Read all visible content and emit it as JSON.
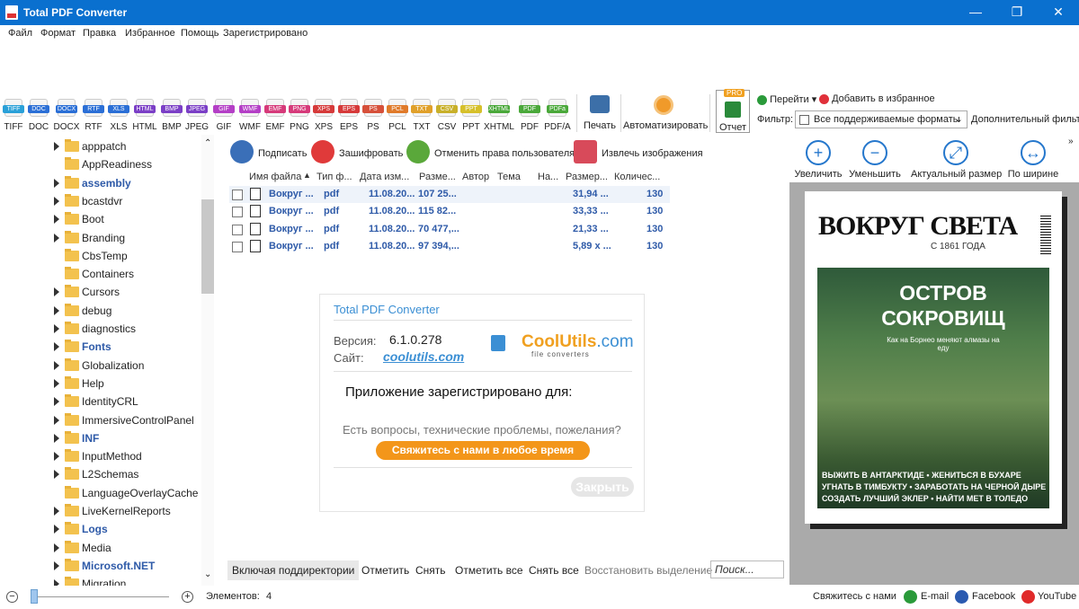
{
  "window": {
    "title": "Total PDF Converter",
    "controls": [
      "—",
      "❐",
      "✕"
    ]
  },
  "menu": [
    "Файл",
    "Формат",
    "Правка",
    "Избранное",
    "Помощь",
    "Зарегистрировано"
  ],
  "formats": [
    {
      "badge": "TIFF",
      "label": "TIFF",
      "color": "#2aa0d8"
    },
    {
      "badge": "DOC",
      "label": "DOC",
      "color": "#2b6fd6"
    },
    {
      "badge": "DOCX",
      "label": "DOCX",
      "color": "#2b6fd6"
    },
    {
      "badge": "RTF",
      "label": "RTF",
      "color": "#2b6fd6"
    },
    {
      "badge": "XLS",
      "label": "XLS",
      "color": "#2b6fd6"
    },
    {
      "badge": "HTML",
      "label": "HTML",
      "color": "#7b3fc6"
    },
    {
      "badge": "BMP",
      "label": "BMP",
      "color": "#7b3fc6"
    },
    {
      "badge": "JPEG",
      "label": "JPEG",
      "color": "#7b3fc6"
    },
    {
      "badge": "GIF",
      "label": "GIF",
      "color": "#b43fc6"
    },
    {
      "badge": "WMF",
      "label": "WMF",
      "color": "#b43fc6"
    },
    {
      "badge": "EMF",
      "label": "EMF",
      "color": "#d63a7a"
    },
    {
      "badge": "PNG",
      "label": "PNG",
      "color": "#d63a7a"
    },
    {
      "badge": "XPS",
      "label": "XPS",
      "color": "#d63a3a"
    },
    {
      "badge": "EPS",
      "label": "EPS",
      "color": "#d63a3a"
    },
    {
      "badge": "PS",
      "label": "PS",
      "color": "#d6503a"
    },
    {
      "badge": "PCL",
      "label": "PCL",
      "color": "#e07a2a"
    },
    {
      "badge": "TXT",
      "label": "TXT",
      "color": "#e0a02a"
    },
    {
      "badge": "CSV",
      "label": "CSV",
      "color": "#c8b02a"
    },
    {
      "badge": "PPT",
      "label": "PPT",
      "color": "#d6c02a"
    },
    {
      "badge": "XHTML",
      "label": "XHTML",
      "color": "#4aa83a"
    },
    {
      "badge": "PDF",
      "label": "PDF",
      "color": "#4aa83a"
    },
    {
      "badge": "PDFa",
      "label": "PDF/A",
      "color": "#4aa83a"
    }
  ],
  "toolbar": {
    "print": "Печать",
    "automate": "Автоматизировать",
    "report": "Отчет",
    "pro": "PRO",
    "goto": "Перейти",
    "add_fav": "Добавить в избранное",
    "filter_label": "Фильтр:",
    "filter_value": "Все поддерживаемые форматы",
    "extra_filter": "Дополнительный фильтр"
  },
  "tree": [
    {
      "name": "apppatch",
      "arrow": true,
      "bold": false
    },
    {
      "name": "AppReadiness",
      "arrow": false,
      "bold": false
    },
    {
      "name": "assembly",
      "arrow": true,
      "bold": true
    },
    {
      "name": "bcastdvr",
      "arrow": true,
      "bold": false
    },
    {
      "name": "Boot",
      "arrow": true,
      "bold": false
    },
    {
      "name": "Branding",
      "arrow": true,
      "bold": false
    },
    {
      "name": "CbsTemp",
      "arrow": false,
      "bold": false
    },
    {
      "name": "Containers",
      "arrow": false,
      "bold": false
    },
    {
      "name": "Cursors",
      "arrow": true,
      "bold": false
    },
    {
      "name": "debug",
      "arrow": true,
      "bold": false
    },
    {
      "name": "diagnostics",
      "arrow": true,
      "bold": false
    },
    {
      "name": "Fonts",
      "arrow": true,
      "bold": true
    },
    {
      "name": "Globalization",
      "arrow": true,
      "bold": false
    },
    {
      "name": "Help",
      "arrow": true,
      "bold": false
    },
    {
      "name": "IdentityCRL",
      "arrow": true,
      "bold": false
    },
    {
      "name": "ImmersiveControlPanel",
      "arrow": true,
      "bold": false
    },
    {
      "name": "INF",
      "arrow": true,
      "bold": true
    },
    {
      "name": "InputMethod",
      "arrow": true,
      "bold": false
    },
    {
      "name": "L2Schemas",
      "arrow": true,
      "bold": false
    },
    {
      "name": "LanguageOverlayCache",
      "arrow": false,
      "bold": false
    },
    {
      "name": "LiveKernelReports",
      "arrow": true,
      "bold": false
    },
    {
      "name": "Logs",
      "arrow": true,
      "bold": true
    },
    {
      "name": "Media",
      "arrow": true,
      "bold": false
    },
    {
      "name": "Microsoft.NET",
      "arrow": true,
      "bold": true
    },
    {
      "name": "Migration",
      "arrow": true,
      "bold": false
    }
  ],
  "actions": {
    "sign": "Подписать",
    "encrypt": "Зашифровать",
    "revoke": "Отменить права пользователя",
    "extract": "Извлечь изображения"
  },
  "columns": [
    "Имя файла",
    "Тип ф...",
    "Дата изм...",
    "Разме...",
    "Автор",
    "Тема",
    "На...",
    "Размер...",
    "Количес..."
  ],
  "files": [
    {
      "name": "Вокруг ...",
      "type": "pdf",
      "date": "11.08.20...",
      "size": "107 25...",
      "psize": "31,94 ...",
      "count": "130"
    },
    {
      "name": "Вокруг ...",
      "type": "pdf",
      "date": "11.08.20...",
      "size": "115 82...",
      "psize": "33,33 ...",
      "count": "130"
    },
    {
      "name": "Вокруг ...",
      "type": "pdf",
      "date": "11.08.20...",
      "size": "70 477,...",
      "psize": "21,33 ...",
      "count": "130"
    },
    {
      "name": "Вокруг ...",
      "type": "pdf",
      "date": "11.08.20...",
      "size": "97 394,...",
      "psize": "5,89 x ...",
      "count": "130"
    }
  ],
  "about": {
    "title": "Total PDF Converter",
    "version_label": "Версия:",
    "version": "6.1.0.278",
    "site_label": "Сайт:",
    "site": "coolutils.com",
    "logo_main": "CoolUtils",
    "logo_dom": ".com",
    "logo_sub": "file converters",
    "registered": "Приложение зарегистрировано для:",
    "question": "Есть вопросы, технические проблемы, пожелания?",
    "contact": "Свяжитесь с нами в любое время",
    "close": "Закрыть"
  },
  "bottom": {
    "subdirs": "Включая поддиректории",
    "mark": "Отметить",
    "unmark": "Снять",
    "mark_all": "Отметить все",
    "unmark_all": "Снять все",
    "restore": "Восстановить выделение",
    "search_placeholder": "Поиск..."
  },
  "viewer": {
    "zoom_in": "Увеличить",
    "zoom_out": "Уменьшить",
    "actual": "Актуальный размер",
    "fit_width": "По ширине"
  },
  "magazine": {
    "masthead": "ВОКРУГ СВЕТА",
    "since": "С 1861 ГОДА",
    "headline": "ОСТРОВ СОКРОВИЩ",
    "subhead": "Как на Борнео меняют алмазы на еду",
    "lines": [
      "ВЫЖИТЬ В АНТАРКТИДЕ • ЖЕНИТЬСЯ В БУХАРЕ",
      "УГНАТЬ В ТИМБУКТУ • ЗАРАБОТАТЬ НА ЧЕРНОЙ ДЫРЕ",
      "СОЗДАТЬ ЛУЧШИЙ ЭКЛЕР • НАЙТИ МЕТ В ТОЛЕДО"
    ]
  },
  "status": {
    "items_label": "Элементов:",
    "items_count": "4",
    "contact": "Свяжитесь с нами",
    "email": "E-mail",
    "facebook": "Facebook",
    "youtube": "YouTube"
  }
}
